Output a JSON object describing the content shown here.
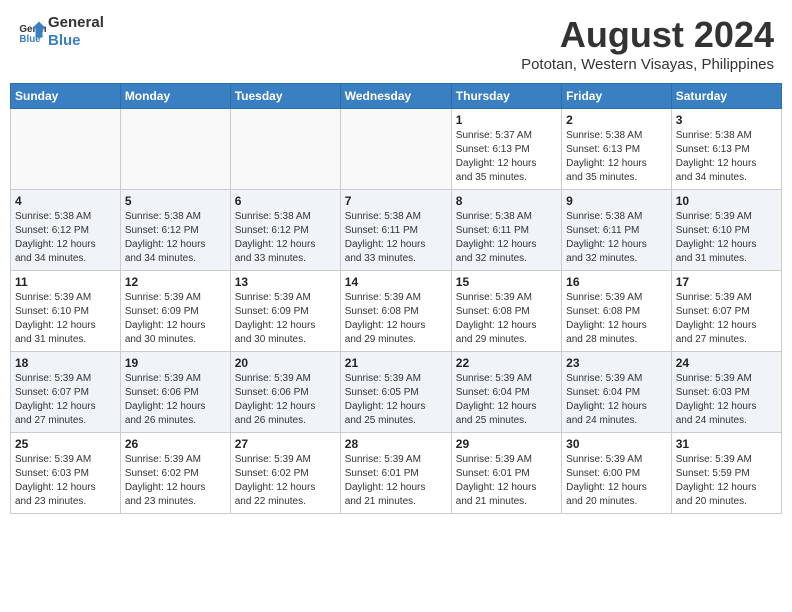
{
  "header": {
    "logo_line1": "General",
    "logo_line2": "Blue",
    "month": "August 2024",
    "location": "Pototan, Western Visayas, Philippines"
  },
  "days_of_week": [
    "Sunday",
    "Monday",
    "Tuesday",
    "Wednesday",
    "Thursday",
    "Friday",
    "Saturday"
  ],
  "weeks": [
    [
      {
        "day": "",
        "detail": ""
      },
      {
        "day": "",
        "detail": ""
      },
      {
        "day": "",
        "detail": ""
      },
      {
        "day": "",
        "detail": ""
      },
      {
        "day": "1",
        "detail": "Sunrise: 5:37 AM\nSunset: 6:13 PM\nDaylight: 12 hours\nand 35 minutes."
      },
      {
        "day": "2",
        "detail": "Sunrise: 5:38 AM\nSunset: 6:13 PM\nDaylight: 12 hours\nand 35 minutes."
      },
      {
        "day": "3",
        "detail": "Sunrise: 5:38 AM\nSunset: 6:13 PM\nDaylight: 12 hours\nand 34 minutes."
      }
    ],
    [
      {
        "day": "4",
        "detail": "Sunrise: 5:38 AM\nSunset: 6:12 PM\nDaylight: 12 hours\nand 34 minutes."
      },
      {
        "day": "5",
        "detail": "Sunrise: 5:38 AM\nSunset: 6:12 PM\nDaylight: 12 hours\nand 34 minutes."
      },
      {
        "day": "6",
        "detail": "Sunrise: 5:38 AM\nSunset: 6:12 PM\nDaylight: 12 hours\nand 33 minutes."
      },
      {
        "day": "7",
        "detail": "Sunrise: 5:38 AM\nSunset: 6:11 PM\nDaylight: 12 hours\nand 33 minutes."
      },
      {
        "day": "8",
        "detail": "Sunrise: 5:38 AM\nSunset: 6:11 PM\nDaylight: 12 hours\nand 32 minutes."
      },
      {
        "day": "9",
        "detail": "Sunrise: 5:38 AM\nSunset: 6:11 PM\nDaylight: 12 hours\nand 32 minutes."
      },
      {
        "day": "10",
        "detail": "Sunrise: 5:39 AM\nSunset: 6:10 PM\nDaylight: 12 hours\nand 31 minutes."
      }
    ],
    [
      {
        "day": "11",
        "detail": "Sunrise: 5:39 AM\nSunset: 6:10 PM\nDaylight: 12 hours\nand 31 minutes."
      },
      {
        "day": "12",
        "detail": "Sunrise: 5:39 AM\nSunset: 6:09 PM\nDaylight: 12 hours\nand 30 minutes."
      },
      {
        "day": "13",
        "detail": "Sunrise: 5:39 AM\nSunset: 6:09 PM\nDaylight: 12 hours\nand 30 minutes."
      },
      {
        "day": "14",
        "detail": "Sunrise: 5:39 AM\nSunset: 6:08 PM\nDaylight: 12 hours\nand 29 minutes."
      },
      {
        "day": "15",
        "detail": "Sunrise: 5:39 AM\nSunset: 6:08 PM\nDaylight: 12 hours\nand 29 minutes."
      },
      {
        "day": "16",
        "detail": "Sunrise: 5:39 AM\nSunset: 6:08 PM\nDaylight: 12 hours\nand 28 minutes."
      },
      {
        "day": "17",
        "detail": "Sunrise: 5:39 AM\nSunset: 6:07 PM\nDaylight: 12 hours\nand 27 minutes."
      }
    ],
    [
      {
        "day": "18",
        "detail": "Sunrise: 5:39 AM\nSunset: 6:07 PM\nDaylight: 12 hours\nand 27 minutes."
      },
      {
        "day": "19",
        "detail": "Sunrise: 5:39 AM\nSunset: 6:06 PM\nDaylight: 12 hours\nand 26 minutes."
      },
      {
        "day": "20",
        "detail": "Sunrise: 5:39 AM\nSunset: 6:06 PM\nDaylight: 12 hours\nand 26 minutes."
      },
      {
        "day": "21",
        "detail": "Sunrise: 5:39 AM\nSunset: 6:05 PM\nDaylight: 12 hours\nand 25 minutes."
      },
      {
        "day": "22",
        "detail": "Sunrise: 5:39 AM\nSunset: 6:04 PM\nDaylight: 12 hours\nand 25 minutes."
      },
      {
        "day": "23",
        "detail": "Sunrise: 5:39 AM\nSunset: 6:04 PM\nDaylight: 12 hours\nand 24 minutes."
      },
      {
        "day": "24",
        "detail": "Sunrise: 5:39 AM\nSunset: 6:03 PM\nDaylight: 12 hours\nand 24 minutes."
      }
    ],
    [
      {
        "day": "25",
        "detail": "Sunrise: 5:39 AM\nSunset: 6:03 PM\nDaylight: 12 hours\nand 23 minutes."
      },
      {
        "day": "26",
        "detail": "Sunrise: 5:39 AM\nSunset: 6:02 PM\nDaylight: 12 hours\nand 23 minutes."
      },
      {
        "day": "27",
        "detail": "Sunrise: 5:39 AM\nSunset: 6:02 PM\nDaylight: 12 hours\nand 22 minutes."
      },
      {
        "day": "28",
        "detail": "Sunrise: 5:39 AM\nSunset: 6:01 PM\nDaylight: 12 hours\nand 21 minutes."
      },
      {
        "day": "29",
        "detail": "Sunrise: 5:39 AM\nSunset: 6:01 PM\nDaylight: 12 hours\nand 21 minutes."
      },
      {
        "day": "30",
        "detail": "Sunrise: 5:39 AM\nSunset: 6:00 PM\nDaylight: 12 hours\nand 20 minutes."
      },
      {
        "day": "31",
        "detail": "Sunrise: 5:39 AM\nSunset: 5:59 PM\nDaylight: 12 hours\nand 20 minutes."
      }
    ]
  ]
}
